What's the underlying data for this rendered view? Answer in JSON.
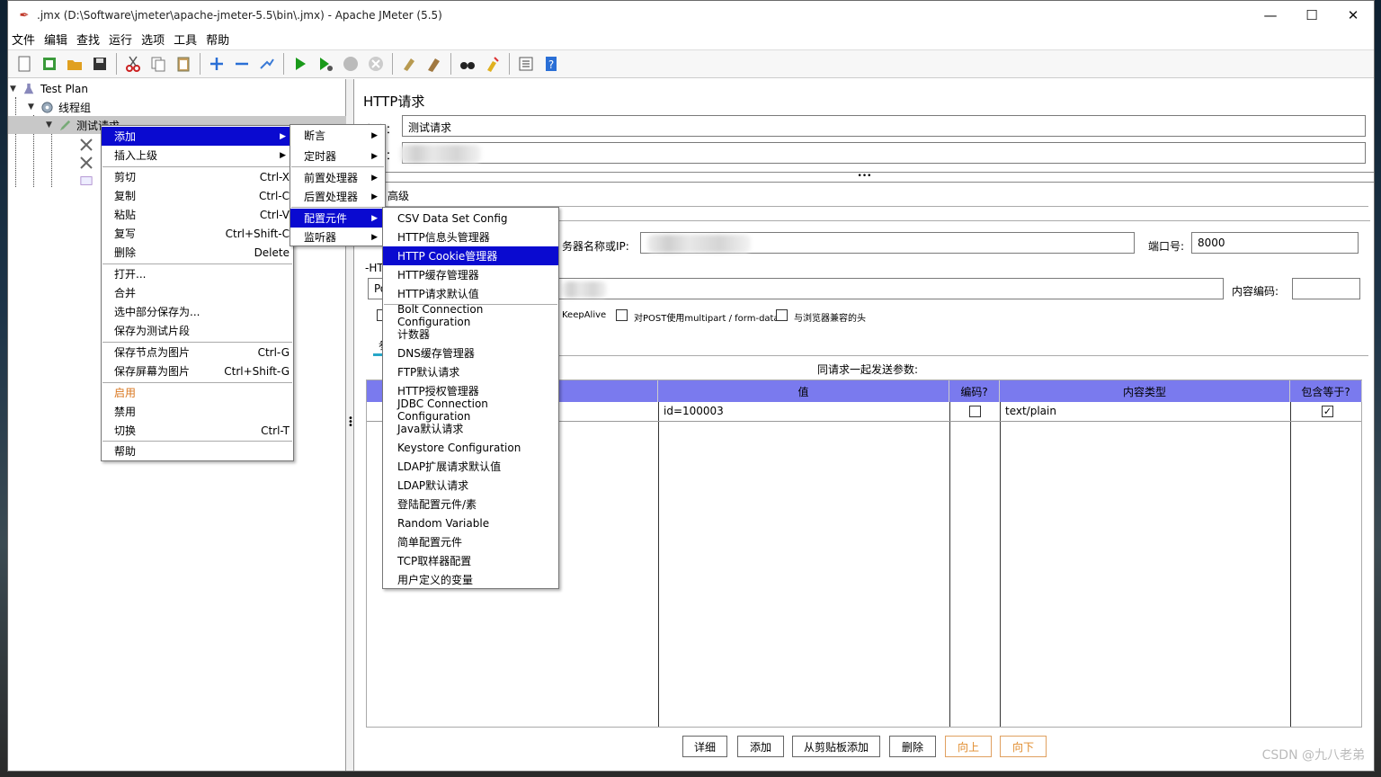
{
  "window": {
    "title": ".jmx (D:\\Software\\jmeter\\apache-jmeter-5.5\\bin\\.jmx) - Apache JMeter (5.5)",
    "min": "—",
    "max": "☐",
    "close": "✕"
  },
  "menubar": [
    "文件",
    "编辑",
    "查找",
    "运行",
    "选项",
    "工具",
    "帮助"
  ],
  "toolbar_icons": [
    "new-icon",
    "templates-icon",
    "open-icon",
    "save-icon",
    "cut-icon",
    "copy-icon",
    "paste-icon",
    "expand-icon",
    "collapse-icon",
    "toggle-icon",
    "start-icon",
    "start-no-pause-icon",
    "stop-icon",
    "shutdown-icon",
    "clear-icon",
    "clear-all-icon",
    "search-icon",
    "reset-search-icon",
    "function-helper-icon",
    "help-icon"
  ],
  "tree": {
    "test_plan": "Test Plan",
    "thread_group": "线程组",
    "sampler": "测试请求"
  },
  "context_menu": {
    "items": [
      {
        "label": "添加",
        "shortcut": "",
        "submenu": true,
        "selected": true
      },
      {
        "label": "插入上级",
        "shortcut": "",
        "submenu": true
      },
      {
        "label": "剪切",
        "shortcut": "Ctrl-X"
      },
      {
        "label": "复制",
        "shortcut": "Ctrl-C"
      },
      {
        "label": "粘贴",
        "shortcut": "Ctrl-V"
      },
      {
        "label": "复写",
        "shortcut": "Ctrl+Shift-C"
      },
      {
        "label": "删除",
        "shortcut": "Delete"
      },
      {
        "label": "打开..."
      },
      {
        "label": "合并"
      },
      {
        "label": "选中部分保存为..."
      },
      {
        "label": "保存为测试片段"
      },
      {
        "label": "保存节点为图片",
        "shortcut": "Ctrl-G"
      },
      {
        "label": "保存屏幕为图片",
        "shortcut": "Ctrl+Shift-G"
      },
      {
        "label": "启用",
        "disabled": true
      },
      {
        "label": "禁用"
      },
      {
        "label": "切换",
        "shortcut": "Ctrl-T"
      },
      {
        "label": "帮助"
      }
    ]
  },
  "add_submenu": [
    "断言",
    "定时器",
    "前置处理器",
    "后置处理器",
    "配置元件",
    "监听器"
  ],
  "config_submenu": {
    "items": [
      "CSV Data Set Config",
      "HTTP信息头管理器",
      "HTTP Cookie管理器",
      "HTTP缓存管理器",
      "HTTP请求默认值",
      "Bolt Connection Configuration",
      "计数器",
      "DNS缓存管理器",
      "FTP默认请求",
      "HTTP授权管理器",
      "JDBC Connection Configuration",
      "Java默认请求",
      "Keystore Configuration",
      "LDAP扩展请求默认值",
      "LDAP默认请求",
      "登陆配置元件/素",
      "Random Variable",
      "简单配置元件",
      "TCP取样器配置",
      "用户定义的变量"
    ],
    "selected_index": 2
  },
  "panel": {
    "title": "HTTP请求",
    "name_label": "名称：",
    "name_value": "测试请求",
    "comment_label": "注释：",
    "advanced_tab": "高级",
    "server_label": "务器名称或IP:",
    "port_label": "端口号:",
    "port_value": "8000",
    "http_label": "-HT",
    "method_value": "Po",
    "encoding_label": "内容编码:",
    "keepalive": "KeepAlive",
    "multipart": "对POST使用multipart / form-data",
    "browser_headers": "与浏览器兼容的头",
    "params_tab": "参",
    "params_caption": "同请求一起发送参数:"
  },
  "params_table": {
    "headers": [
      "",
      "值",
      "编码?",
      "内容类型",
      "包含等于?"
    ],
    "rows": [
      {
        "value": "id=100003",
        "encode": false,
        "content_type": "text/plain",
        "include_equals": true
      }
    ]
  },
  "buttons": [
    "详细",
    "添加",
    "从剪贴板添加",
    "删除",
    "向上",
    "向下"
  ],
  "watermark": "CSDN @九八老弟",
  "colors": {
    "selection": "#0a0ad0",
    "table_header": "#7a7aee",
    "disabled": "#d9761e"
  }
}
